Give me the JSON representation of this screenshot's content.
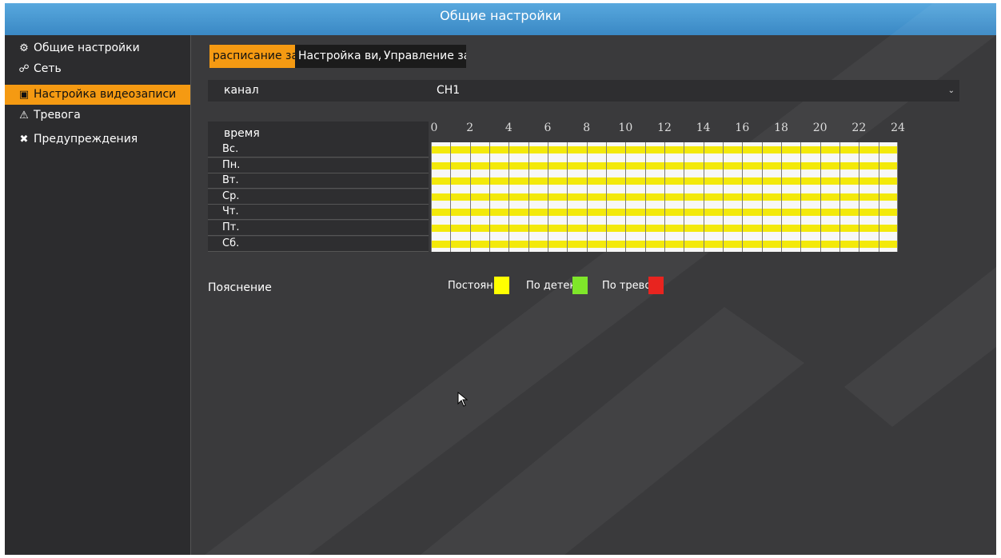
{
  "window": {
    "title": "Общие настройки"
  },
  "sidebar": {
    "items": [
      {
        "label": "Общие настройки",
        "icon": "gears-icon",
        "active": false
      },
      {
        "label": "Сеть",
        "icon": "network-icon",
        "active": false
      },
      {
        "label": "Настройка видеозаписи",
        "icon": "film-icon",
        "active": true
      },
      {
        "label": "Тревога",
        "icon": "warning-icon",
        "active": false
      },
      {
        "label": "Предупреждения",
        "icon": "tools-icon",
        "active": false
      }
    ]
  },
  "tabs": [
    {
      "label": "расписание записи",
      "active": true
    },
    {
      "label": "Настройка видеозаписи",
      "active": false
    },
    {
      "label": "Управление записью",
      "active": false
    }
  ],
  "channel": {
    "label": "канал",
    "value": "CH1"
  },
  "schedule": {
    "time_label": "время",
    "hour_ticks": [
      "0",
      "2",
      "4",
      "6",
      "8",
      "10",
      "12",
      "14",
      "16",
      "18",
      "20",
      "22",
      "24"
    ],
    "days": [
      "Вс.",
      "Пн.",
      "Вт.",
      "Ср.",
      "Чт.",
      "Пт.",
      "Сб."
    ],
    "mode_all_days": "Постоянная",
    "fill_fraction": 1.0
  },
  "legend": {
    "title": "Пояснение",
    "items": [
      {
        "label": "Постоянная",
        "color": "#ffff00"
      },
      {
        "label": "По детекции",
        "color": "#7fe62a"
      },
      {
        "label": "По тревоге",
        "color": "#e8241f"
      }
    ]
  },
  "colors": {
    "accent": "#f59a12",
    "title_bar": "#4a9ad4",
    "schedule_fill": "#f3e90a"
  }
}
